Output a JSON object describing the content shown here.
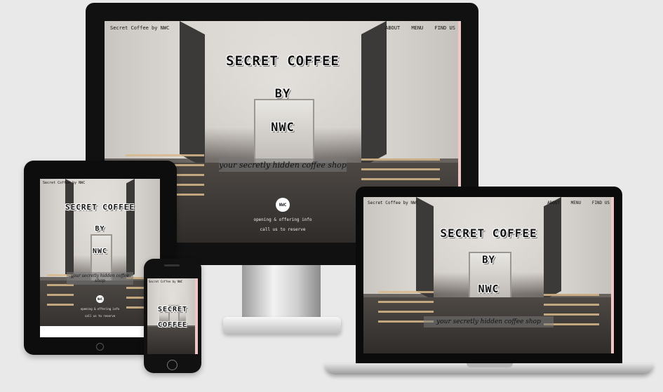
{
  "site": {
    "brand": "Secret Coffee by NWC",
    "nav_links": [
      "ABOUT",
      "MENU",
      "FIND US"
    ],
    "hero_lines": [
      "SECRET COFFEE",
      "BY",
      "NWC"
    ],
    "tagline": "your secretly hidden coffee shop",
    "logo_text": "NWC",
    "info_lines": [
      "opening & offering info",
      "call us to reserve"
    ]
  },
  "colors": {
    "background": "#e9e9e9",
    "device_bezel": "#111111",
    "accent_pink": "#f0c6c6"
  }
}
